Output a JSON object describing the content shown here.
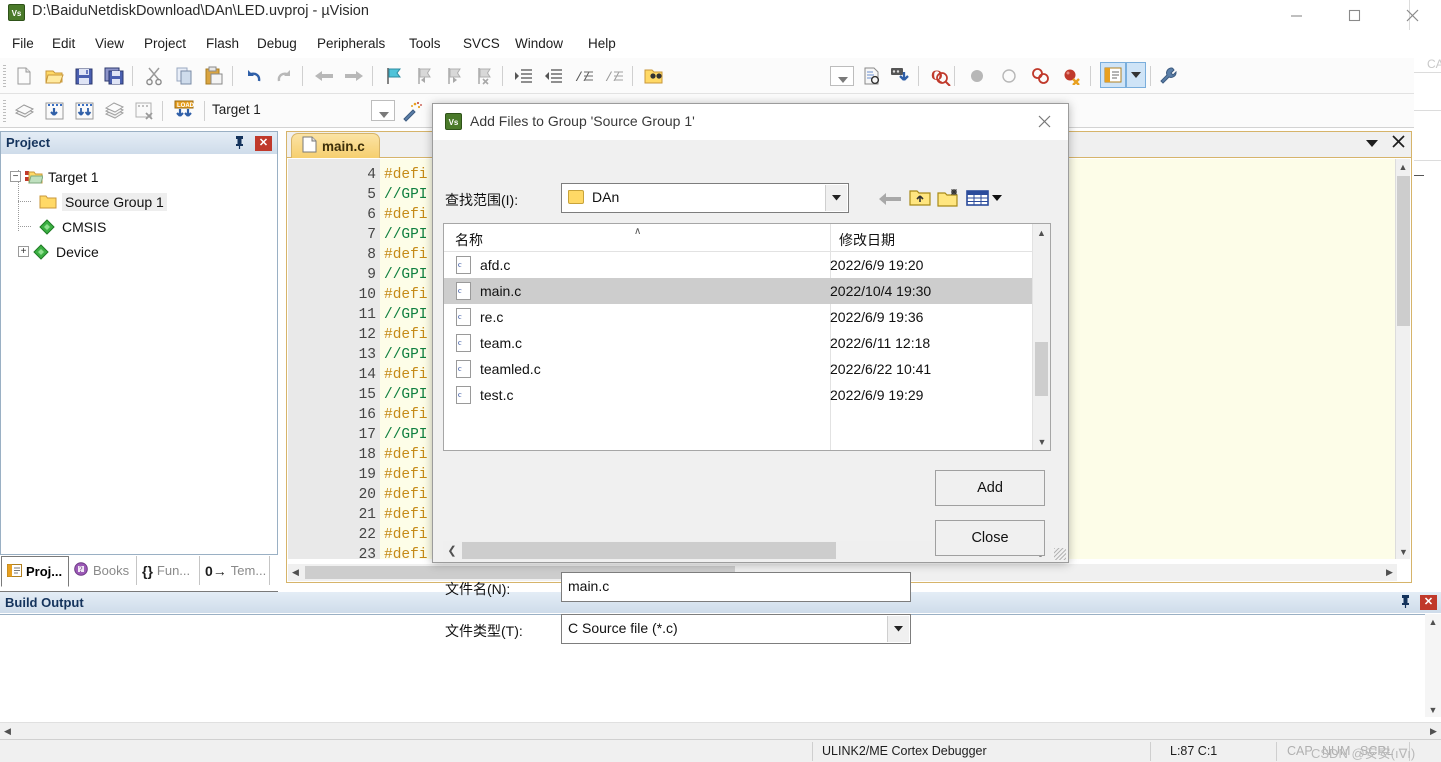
{
  "window": {
    "title": "D:\\BaiduNetdiskDownload\\DAn\\LED.uvproj - µVision",
    "icon": "uvision-logo-icon",
    "minimize_label": "—",
    "maximize_label": "❑",
    "close_label": "✕"
  },
  "menubar": {
    "items": [
      {
        "label": "File"
      },
      {
        "label": "Edit"
      },
      {
        "label": "View"
      },
      {
        "label": "Project"
      },
      {
        "label": "Flash"
      },
      {
        "label": "Debug"
      },
      {
        "label": "Peripherals"
      },
      {
        "label": "Tools"
      },
      {
        "label": "SVCS"
      },
      {
        "label": "Window"
      },
      {
        "label": "Help"
      }
    ]
  },
  "toolbar_main": {
    "buttons": [
      {
        "name": "new-file-icon"
      },
      {
        "name": "open-file-icon"
      },
      {
        "name": "save-icon"
      },
      {
        "name": "save-all-icon"
      },
      {
        "name": "cut-icon"
      },
      {
        "name": "copy-icon"
      },
      {
        "name": "paste-icon"
      },
      {
        "name": "undo-icon"
      },
      {
        "name": "redo-icon"
      },
      {
        "name": "navigate-back-icon"
      },
      {
        "name": "navigate-forward-icon"
      },
      {
        "name": "bookmark-toggle-icon"
      },
      {
        "name": "bookmark-prev-icon"
      },
      {
        "name": "bookmark-next-icon"
      },
      {
        "name": "bookmark-clear-icon"
      },
      {
        "name": "indent-increase-icon"
      },
      {
        "name": "indent-decrease-icon"
      },
      {
        "name": "comment-lines-icon"
      },
      {
        "name": "uncomment-lines-icon"
      },
      {
        "name": "open-folder-search-icon"
      },
      {
        "name": "dropdown-blank-icon"
      },
      {
        "name": "insert-file-icon"
      },
      {
        "name": "configure-icon"
      },
      {
        "name": "find-in-files-icon"
      },
      {
        "name": "breakpoint-set-icon"
      },
      {
        "name": "breakpoint-clear-icon"
      },
      {
        "name": "breakpoint-disable-icon"
      },
      {
        "name": "breakpoint-kill-all-icon"
      },
      {
        "name": "project-window-icon"
      },
      {
        "name": "project-window-dropdown-icon"
      },
      {
        "name": "options-target-icon"
      }
    ]
  },
  "toolbar_build": {
    "buttons": [
      {
        "name": "translate-icon"
      },
      {
        "name": "build-icon"
      },
      {
        "name": "rebuild-all-icon"
      },
      {
        "name": "batch-build-icon"
      },
      {
        "name": "stop-build-icon"
      },
      {
        "name": "download-to-flash-icon"
      }
    ],
    "target_selector": {
      "name": "target-selector",
      "value": "Target 1"
    },
    "manage_project_items": {
      "name": "manage-project-items-icon"
    }
  },
  "project_panel": {
    "title": "Project",
    "pin_icon": "pin-icon",
    "close_icon": "close-icon",
    "tree": [
      {
        "label": "Target 1",
        "icon": "target-folder-icon",
        "expander": "−",
        "level": 0,
        "selected": false
      },
      {
        "label": "Source Group 1",
        "icon": "folder-icon",
        "expander": "",
        "level": 1,
        "selected": true
      },
      {
        "label": "CMSIS",
        "icon": "green-diamond-icon",
        "expander": "",
        "level": 1,
        "selected": false
      },
      {
        "label": "Device",
        "icon": "green-diamond-icon",
        "expander": "+",
        "level": 1,
        "selected": false
      }
    ],
    "tabs": [
      {
        "label": "Proj...",
        "icon": "project-icon",
        "active": true
      },
      {
        "label": "Books",
        "icon": "books-icon",
        "active": false
      },
      {
        "label": "Fun...",
        "icon": "functions-icon",
        "active": false
      },
      {
        "label": "Tem...",
        "icon": "templates-icon",
        "active": false
      }
    ]
  },
  "editor": {
    "tab": {
      "label": "main.c",
      "icon": "file-icon"
    },
    "panel_dropdown_icon": "chevron-down-icon",
    "panel_close_icon": "close-icon",
    "lines": [
      {
        "num": "4",
        "text": "#defi",
        "kind": "define"
      },
      {
        "num": "5",
        "text": "//GPI",
        "kind": "comment"
      },
      {
        "num": "6",
        "text": "#defi",
        "kind": "define"
      },
      {
        "num": "7",
        "text": "//GPI",
        "kind": "comment"
      },
      {
        "num": "8",
        "text": "#defi",
        "kind": "define"
      },
      {
        "num": "9",
        "text": "//GPI",
        "kind": "comment"
      },
      {
        "num": "10",
        "text": "#defi",
        "kind": "define"
      },
      {
        "num": "11",
        "text": "//GPI",
        "kind": "comment"
      },
      {
        "num": "12",
        "text": "#defi",
        "kind": "define"
      },
      {
        "num": "13",
        "text": "//GPI",
        "kind": "comment"
      },
      {
        "num": "14",
        "text": "#defi",
        "kind": "define"
      },
      {
        "num": "15",
        "text": "//GPI",
        "kind": "comment"
      },
      {
        "num": "16",
        "text": "#defi",
        "kind": "define"
      },
      {
        "num": "17",
        "text": "//GPI",
        "kind": "comment"
      },
      {
        "num": "18",
        "text": "#defi",
        "kind": "define"
      },
      {
        "num": "19",
        "text": "#defi",
        "kind": "define"
      },
      {
        "num": "20",
        "text": "#defi",
        "kind": "define"
      },
      {
        "num": "21",
        "text": "#defi",
        "kind": "define"
      },
      {
        "num": "22",
        "text": "#defi",
        "kind": "define"
      },
      {
        "num": "23",
        "text": "#defi",
        "kind": "define"
      }
    ]
  },
  "build_output": {
    "title": "Build Output",
    "pin_icon": "pin-icon",
    "close_icon": "close-icon",
    "content": ""
  },
  "statusbar": {
    "debugger": "ULINK2/ME Cortex Debugger",
    "cursor": "L:87 C:1",
    "cap": "CAP",
    "num": "NUM",
    "scrl": "SCRL",
    "watermark": "CSDN @安安(ı∇ı)"
  },
  "dialog": {
    "title": "Add Files to Group 'Source Group 1'",
    "icon": "uvision-logo-icon",
    "close_label": "✕",
    "look_in": {
      "label": "查找范围(I):",
      "value": "DAn",
      "folder_icon": "folder-icon",
      "arrow_icon": "chevron-down-icon"
    },
    "nav_buttons": [
      {
        "name": "back-arrow-icon"
      },
      {
        "name": "up-one-level-icon"
      },
      {
        "name": "new-folder-icon"
      },
      {
        "name": "view-mode-icon"
      }
    ],
    "file_list": {
      "columns": [
        "名称",
        "修改日期"
      ],
      "sort_caret": "∧",
      "rows": [
        {
          "name": "afd.c",
          "date": "2022/6/9 19:20",
          "icon": "c-file-icon",
          "selected": false
        },
        {
          "name": "main.c",
          "date": "2022/10/4 19:30",
          "icon": "c-file-icon",
          "selected": true
        },
        {
          "name": "re.c",
          "date": "2022/6/9 19:36",
          "icon": "c-file-icon",
          "selected": false
        },
        {
          "name": "team.c",
          "date": "2022/6/11 12:18",
          "icon": "c-file-icon",
          "selected": false
        },
        {
          "name": "teamled.c",
          "date": "2022/6/22 10:41",
          "icon": "c-file-icon",
          "selected": false
        },
        {
          "name": "test.c",
          "date": "2022/6/9 19:29",
          "icon": "c-file-icon",
          "selected": false
        }
      ]
    },
    "file_name": {
      "label": "文件名(N):",
      "value": "main.c",
      "placeholder": ""
    },
    "file_type": {
      "label": "文件类型(T):",
      "value": "C Source file (*.c)",
      "arrow_icon": "chevron-down-icon"
    },
    "buttons": [
      {
        "name": "add-button",
        "label": "Add"
      },
      {
        "name": "close-button",
        "label": "Close"
      }
    ]
  },
  "colors": {
    "accent": "#cfdcea",
    "tab_active": "#f6cf6f",
    "define_keyword": "#c58a17",
    "comment": "#108040",
    "selection": "#cdcdcd",
    "panel_close": "#c0392b"
  }
}
